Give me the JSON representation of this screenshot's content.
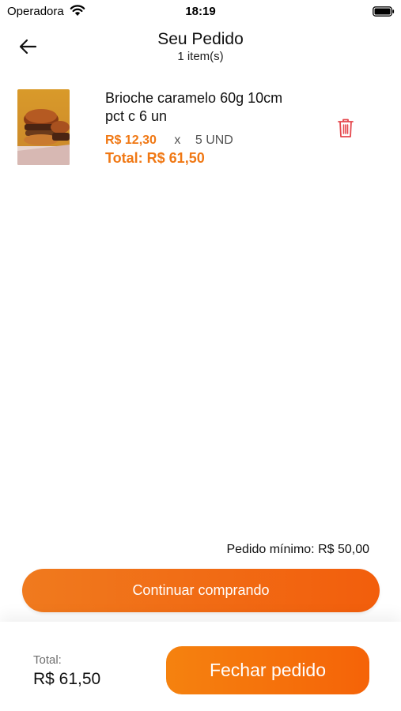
{
  "status_bar": {
    "carrier": "Operadora",
    "time": "18:19"
  },
  "header": {
    "title": "Seu Pedido",
    "item_count": "1 item(s)"
  },
  "cart": {
    "items": [
      {
        "name": "Brioche caramelo 60g 10cm pct c 6 un",
        "unit_price": "R$ 12,30",
        "times": "x",
        "quantity": "5 UND",
        "total": "Total: R$ 61,50"
      }
    ]
  },
  "minimum_order": "Pedido mínimo: R$ 50,00",
  "continue_label": "Continuar comprando",
  "footer": {
    "total_label": "Total:",
    "total_value": "R$ 61,50",
    "checkout_label": "Fechar pedido"
  },
  "colors": {
    "accent": "#f07814",
    "delete": "#e5484d"
  },
  "icons": {
    "back": "arrow-left-icon",
    "delete": "trash-icon",
    "wifi": "wifi-icon",
    "battery": "battery-icon"
  }
}
